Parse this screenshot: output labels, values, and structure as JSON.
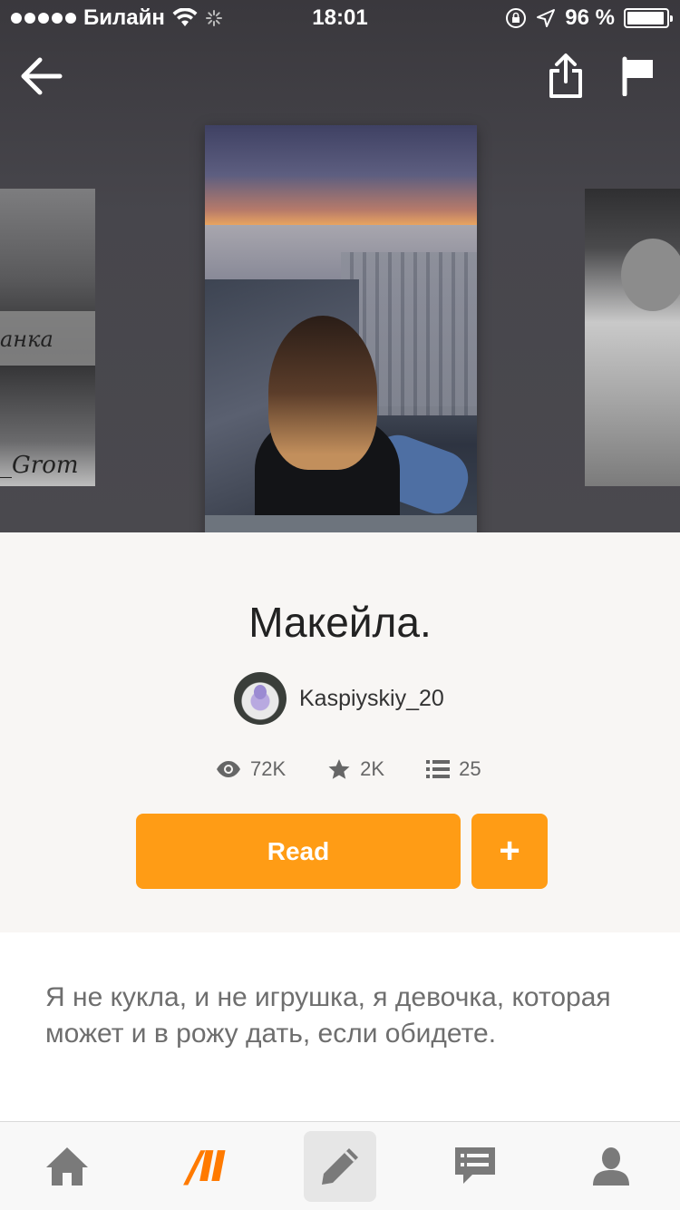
{
  "status_bar": {
    "carrier": "Билайн",
    "time": "18:01",
    "battery": "96 %"
  },
  "header": {
    "icons": [
      "back-arrow-icon",
      "share-icon",
      "flag-icon"
    ]
  },
  "covers": {
    "left": {
      "label": "анка",
      "author": "_Grom"
    },
    "center": {},
    "right": {}
  },
  "story": {
    "title": "Макейла.",
    "author": "Kaspiyskiy_20",
    "stats": {
      "views": "72K",
      "votes": "2K",
      "parts": "25"
    },
    "read_label": "Read",
    "add_label": "+",
    "description": "Я не кукла, и не игрушка, я девочка, которая может и в рожу дать, если обидете."
  },
  "tabbar": {
    "items": [
      "home-icon",
      "wattpad-logo",
      "write-icon",
      "messages-icon",
      "profile-icon"
    ],
    "logo_text": "/II",
    "active_index": 2
  },
  "colors": {
    "accent": "#ff9c15",
    "logo": "#ff7a00",
    "hero_bg": "#47464c",
    "info_bg": "#f8f6f4"
  }
}
